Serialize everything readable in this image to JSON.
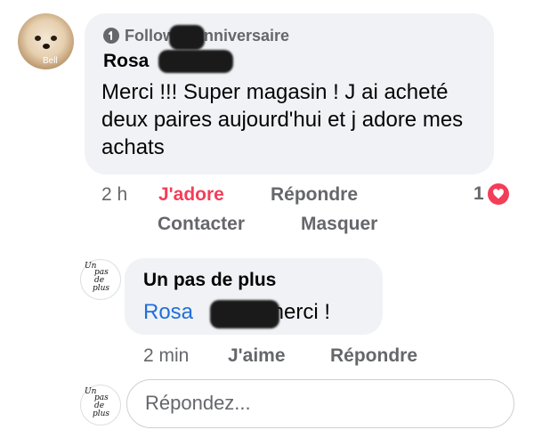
{
  "comment": {
    "avatar_caption": "Bell",
    "badge": "Follower anniversaire",
    "author_first": "Rosa",
    "text": "Merci !!! Super magasin ! J ai acheté deux paires aujourd'hui et j adore mes achats",
    "time": "2 h",
    "reaction_label": "J'adore",
    "reply_label": "Répondre",
    "reaction_count": "1",
    "contact_label": "Contacter",
    "hide_label": "Masquer"
  },
  "reply": {
    "author": "Un pas de plus",
    "mention_first": "Rosa",
    "text": "merci !",
    "time": "2 min",
    "like_label": "J'aime",
    "reply_label": "Répondre"
  },
  "logo": {
    "line1": "Un",
    "line2": "pas",
    "line3": "de",
    "line4": "plus"
  },
  "composer": {
    "placeholder": "Répondez..."
  },
  "colors": {
    "love": "#f33e58",
    "mention": "#216fdb",
    "secondary_text": "#65676b",
    "bubble": "#f0f2f5"
  }
}
